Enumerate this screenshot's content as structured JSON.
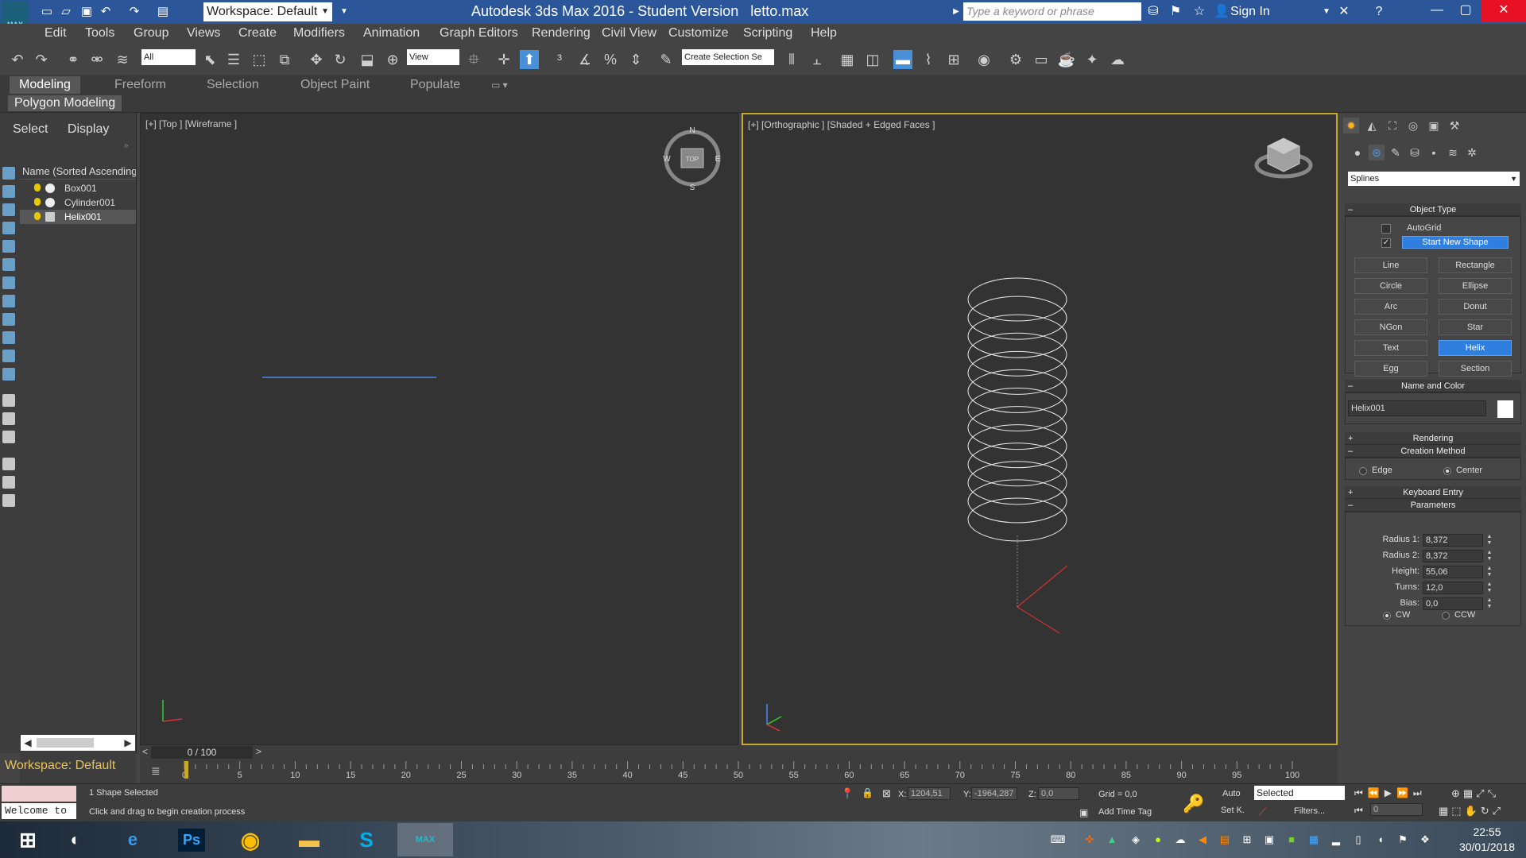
{
  "titlebar": {
    "workspace": "Workspace: Default",
    "app_title": "Autodesk 3ds Max 2016 - Student Version",
    "file_name": "letto.max",
    "search_placeholder": "Type a keyword or phrase",
    "sign_in": "Sign In",
    "logo_text": "MAX"
  },
  "menu": [
    "Edit",
    "Tools",
    "Group",
    "Views",
    "Create",
    "Modifiers",
    "Animation",
    "Graph Editors",
    "Rendering",
    "Civil View",
    "Customize",
    "Scripting",
    "Help"
  ],
  "toolbar": {
    "filter_value": "All",
    "refcoord_value": "View",
    "selection_set_placeholder": "Create Selection Se"
  },
  "ribbon": {
    "tabs": [
      "Modeling",
      "Freeform",
      "Selection",
      "Object Paint",
      "Populate"
    ],
    "active_tab": "Modeling",
    "panel_label": "Polygon Modeling"
  },
  "explorer": {
    "tabs": [
      "Select",
      "Display"
    ],
    "header": "Name (Sorted Ascending)",
    "items": [
      {
        "name": "Box001",
        "selected": false
      },
      {
        "name": "Cylinder001",
        "selected": false
      },
      {
        "name": "Helix001",
        "selected": true
      }
    ],
    "workspace_label": "Workspace: Default"
  },
  "viewports": {
    "left_label": "[+] [Top ] [Wireframe ]",
    "right_label": "[+] [Orthographic ] [Shaded + Edged Faces ]",
    "compass": {
      "n": "N",
      "s": "S",
      "w": "W",
      "e": "E",
      "center": "TOP"
    }
  },
  "timeline": {
    "frame": "0 / 100",
    "ticks": [
      0,
      5,
      10,
      15,
      20,
      25,
      30,
      35,
      40,
      45,
      50,
      55,
      60,
      65,
      70,
      75,
      80,
      85,
      90,
      95,
      100
    ]
  },
  "status": {
    "welcome": "Welcome to",
    "selection": "1 Shape Selected",
    "prompt": "Click and drag to begin creation process",
    "x_label": "X:",
    "x": "1204,51",
    "y_label": "Y:",
    "y": "-1964,287",
    "z_label": "Z:",
    "z": "0,0",
    "grid": "Grid = 0,0",
    "add_time_tag": "Add Time Tag",
    "auto": "Auto",
    "set_key": "Set K.",
    "selected_dropdown": "Selected",
    "filters": "Filters...",
    "frame_field": "0"
  },
  "command_panel": {
    "category_dropdown": "Splines",
    "object_type_title": "Object Type",
    "autogrid_label": "AutoGrid",
    "autogrid_checked": false,
    "start_new_shape_label": "Start New Shape",
    "start_new_shape_checked": true,
    "buttons": [
      {
        "label": "Line",
        "active": false
      },
      {
        "label": "Rectangle",
        "active": false
      },
      {
        "label": "Circle",
        "active": false
      },
      {
        "label": "Ellipse",
        "active": false
      },
      {
        "label": "Arc",
        "active": false
      },
      {
        "label": "Donut",
        "active": false
      },
      {
        "label": "NGon",
        "active": false
      },
      {
        "label": "Star",
        "active": false
      },
      {
        "label": "Text",
        "active": false
      },
      {
        "label": "Helix",
        "active": true
      },
      {
        "label": "Egg",
        "active": false
      },
      {
        "label": "Section",
        "active": false
      }
    ],
    "name_color_title": "Name and Color",
    "object_name": "Helix001",
    "object_color": "#ffffff",
    "rendering_title": "Rendering",
    "creation_method_title": "Creation Method",
    "creation_options": [
      {
        "label": "Edge",
        "selected": false
      },
      {
        "label": "Center",
        "selected": true
      }
    ],
    "keyboard_entry_title": "Keyboard Entry",
    "parameters_title": "Parameters",
    "params": [
      {
        "label": "Radius 1:",
        "value": "8,372"
      },
      {
        "label": "Radius 2:",
        "value": "8,372"
      },
      {
        "label": "Height:",
        "value": "55,06"
      },
      {
        "label": "Turns:",
        "value": "12,0"
      },
      {
        "label": "Bias:",
        "value": "0,0"
      }
    ],
    "direction_options": [
      {
        "label": "CW",
        "selected": true
      },
      {
        "label": "CCW",
        "selected": false
      }
    ]
  },
  "taskbar": {
    "time": "22:55",
    "date": "30/01/2018",
    "ps_label": "Ps",
    "max_label": "MAX"
  },
  "colors": {
    "title_bar": "#2b579a",
    "accent": "#2f7fe0",
    "active_viewport_border": "#c8a82a",
    "helix_wire": "#e8e8e8"
  }
}
